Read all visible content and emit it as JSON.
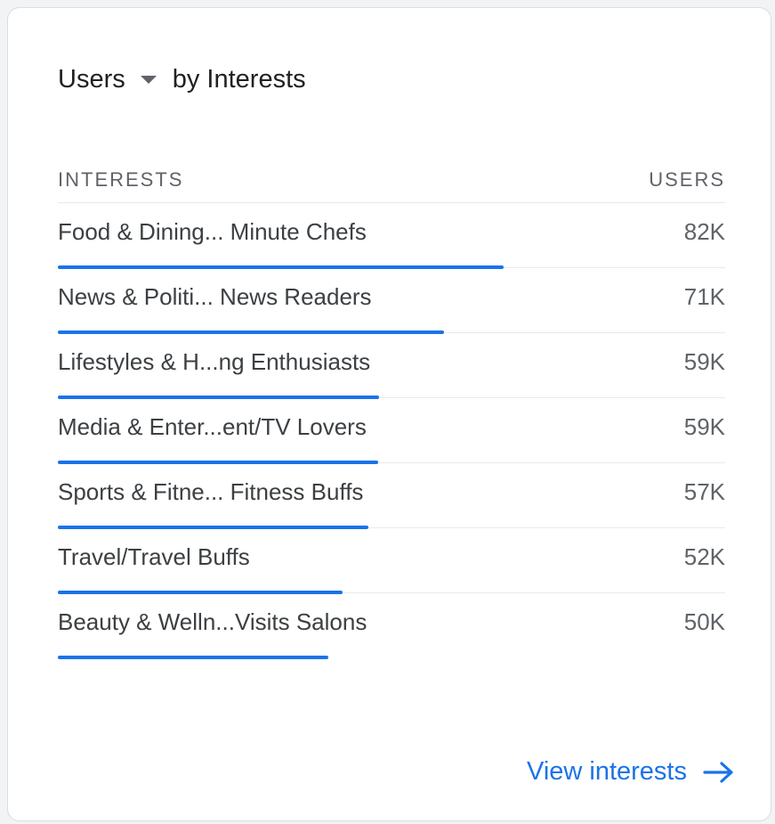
{
  "card": {
    "metric_label": "Users",
    "by_label": "by Interests"
  },
  "table": {
    "col_interests": "INTERESTS",
    "col_users": "USERS",
    "rows": [
      {
        "label": "Food & Dining... Minute Chefs",
        "value": "82K",
        "fraction": 1.0
      },
      {
        "label": "News & Politi... News Readers",
        "value": "71K",
        "fraction": 0.866
      },
      {
        "label": "Lifestyles & H...ng Enthusiasts",
        "value": "59K",
        "fraction": 0.72
      },
      {
        "label": "Media & Enter...ent/TV Lovers",
        "value": "59K",
        "fraction": 0.718
      },
      {
        "label": "Sports & Fitne... Fitness Buffs",
        "value": "57K",
        "fraction": 0.696
      },
      {
        "label": "Travel/Travel Buffs",
        "value": "52K",
        "fraction": 0.638
      },
      {
        "label": "Beauty & Welln...Visits Salons",
        "value": "50K",
        "fraction": 0.606
      }
    ]
  },
  "footer": {
    "link_label": "View interests",
    "link_icon": "arrow-right-icon"
  },
  "colors": {
    "accent": "#1a73e8",
    "text": "#3c4043",
    "muted": "#5f6368",
    "divider": "#e8eaed"
  }
}
